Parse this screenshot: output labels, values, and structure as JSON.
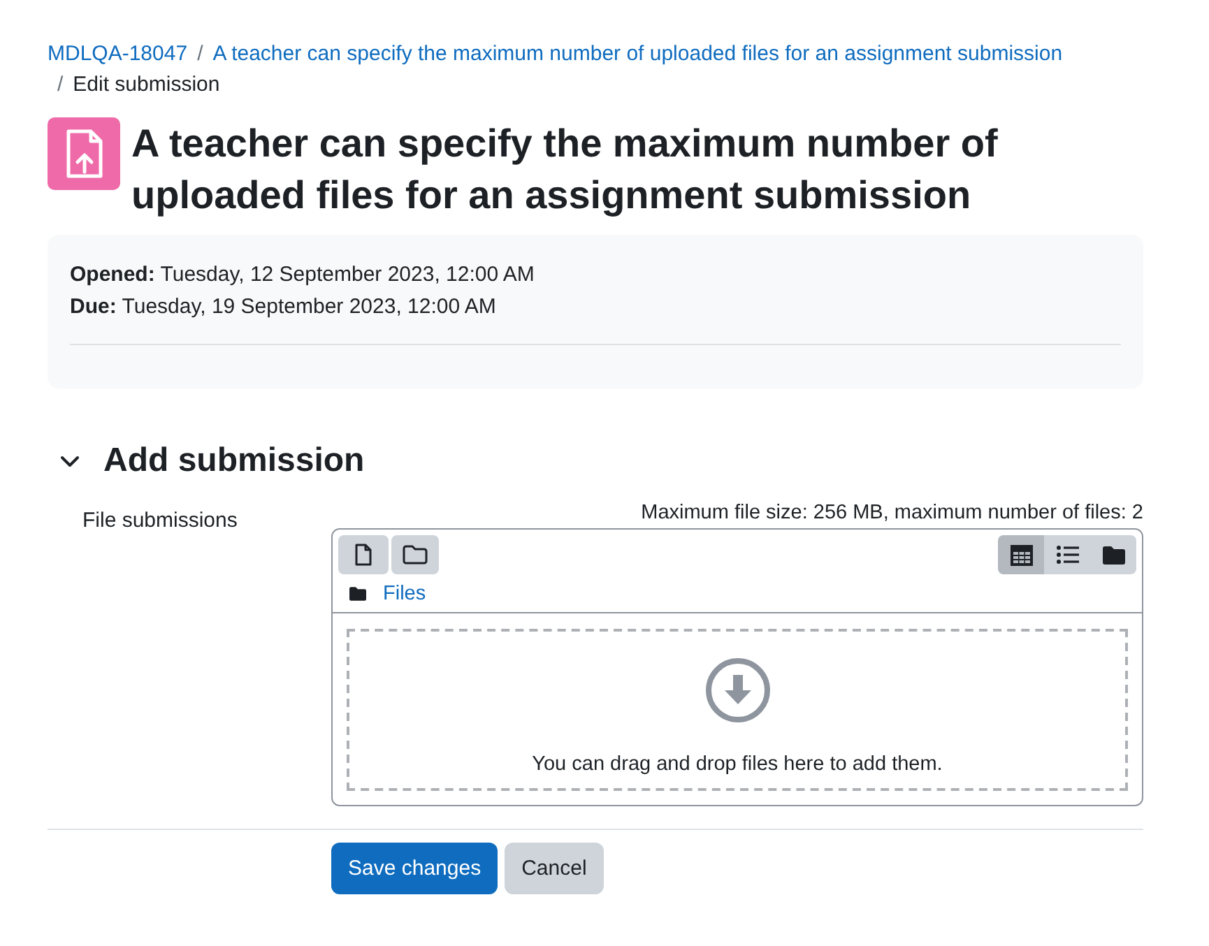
{
  "breadcrumb": [
    {
      "kind": "link",
      "label": "MDLQA-18047"
    },
    {
      "kind": "link",
      "separator": "/",
      "label": "A teacher can specify the maximum number of uploaded files for an assignment submission"
    },
    {
      "kind": "current",
      "separator": "/",
      "label": "Edit submission"
    }
  ],
  "page_title": "A teacher can specify the maximum number of uploaded files for an assignment submission",
  "dates": [
    {
      "label": "Opened:",
      "value": "Tuesday, 12 September 2023, 12:00 AM"
    },
    {
      "label": "Due:",
      "value": "Tuesday, 19 September 2023, 12:00 AM"
    }
  ],
  "section": {
    "title": "Add submission",
    "expanded": true
  },
  "field": {
    "label": "File submissions",
    "limits": "Maximum file size: 256 MB, maximum number of files: 2"
  },
  "filepicker": {
    "views": [
      {
        "kind": "icons",
        "selected": true
      },
      {
        "kind": "list",
        "selected": false
      },
      {
        "kind": "tree",
        "selected": false
      }
    ],
    "path": "Files",
    "dropzone_text": "You can drag and drop files here to add them."
  },
  "buttons": [
    {
      "kind": "primary",
      "label": "Save changes"
    },
    {
      "kind": "secondary",
      "label": "Cancel"
    }
  ]
}
